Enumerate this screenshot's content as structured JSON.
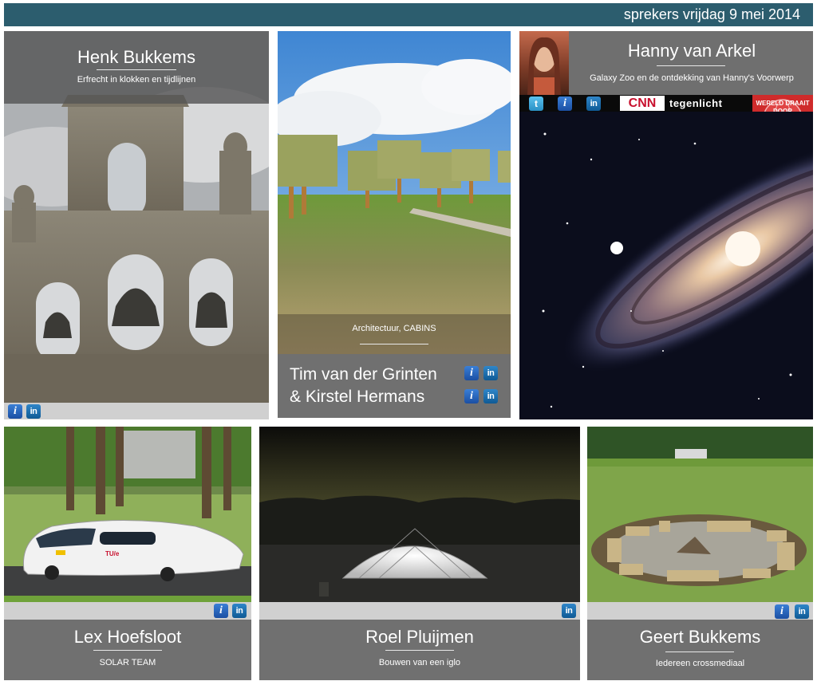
{
  "header": {
    "title": "sprekers  vrijdag 9 mei 2014"
  },
  "speakers": [
    {
      "name": "Henk Bukkems",
      "subtitle": "Erfrecht in klokken en tijdlijnen"
    },
    {
      "name": "Tim van der Grinten",
      "name2": "& Kirstel Hermans",
      "subtitle": "Architectuur, CABINS"
    },
    {
      "name": "Hanny van Arkel",
      "subtitle": "Galaxy Zoo en de ontdekking van Hanny's Voorwerp"
    },
    {
      "name": "Lex Hoefsloot",
      "subtitle": "SOLAR TEAM"
    },
    {
      "name": "Roel Pluijmen",
      "subtitle": "Bouwen van een iglo"
    },
    {
      "name": "Geert Bukkems",
      "subtitle": "Iedereen crossmediaal"
    }
  ],
  "icons": {
    "info": "i",
    "linkedin": "in",
    "twitter": "t"
  },
  "media": {
    "cnn": "CNN",
    "tegenlicht": "tegenlicht",
    "wereld": "WERELD DRAAIT DOOR"
  },
  "car": {
    "logo": "TU/e"
  }
}
